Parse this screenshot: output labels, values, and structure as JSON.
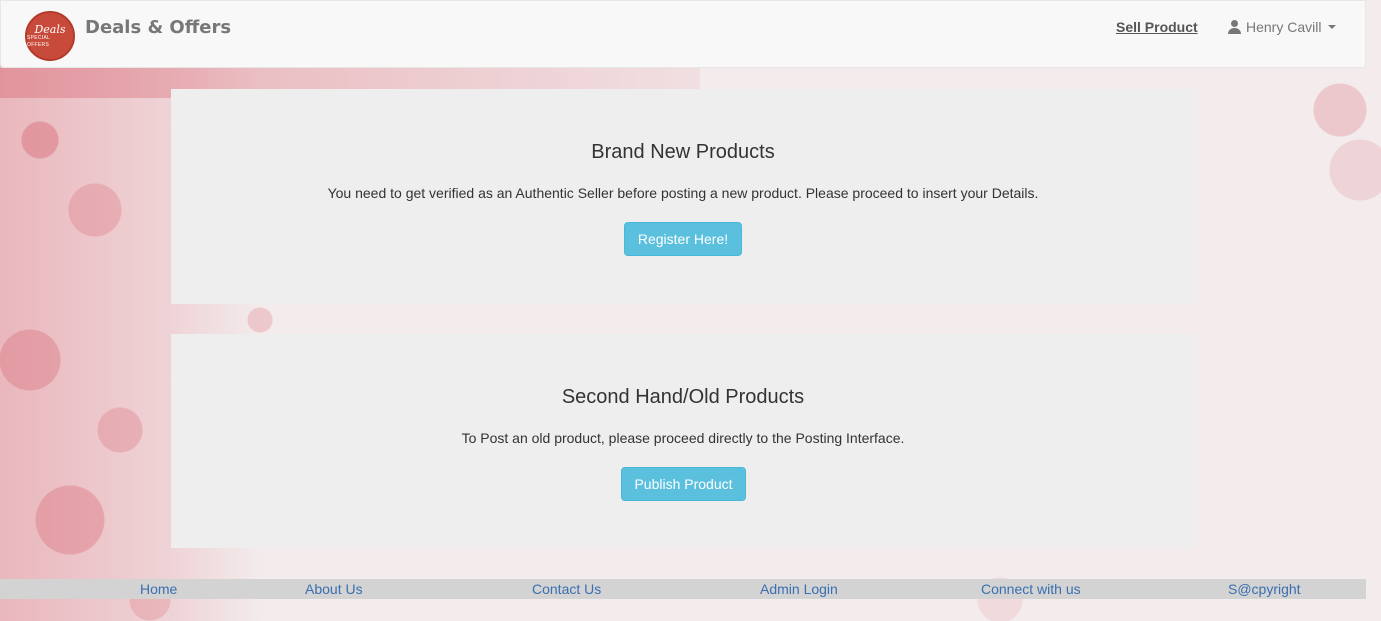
{
  "navbar": {
    "brand": "Deals & Offers",
    "logo": {
      "text_main": "Deals",
      "text_sub": "SPECIAL OFFERS",
      "color": "#c74a3a"
    },
    "sell_link": "Sell Product",
    "user_name": "Henry Cavill",
    "user_icon": "user-icon"
  },
  "panels": [
    {
      "title": "Brand New Products",
      "description": "You need to get verified as an Authentic Seller before posting a new product. Please proceed to insert your Details.",
      "button": "Register Here!"
    },
    {
      "title": "Second Hand/Old Products",
      "description": "To Post an old product, please proceed directly to the Posting Interface.",
      "button": "Publish Product"
    }
  ],
  "footer": {
    "links": [
      "Home",
      "About Us",
      "Contact Us",
      "Admin Login",
      "Connect with us",
      "S@cpyright"
    ]
  },
  "colors": {
    "accent_button": "#5bc0de",
    "link": "#3a6fb0"
  }
}
